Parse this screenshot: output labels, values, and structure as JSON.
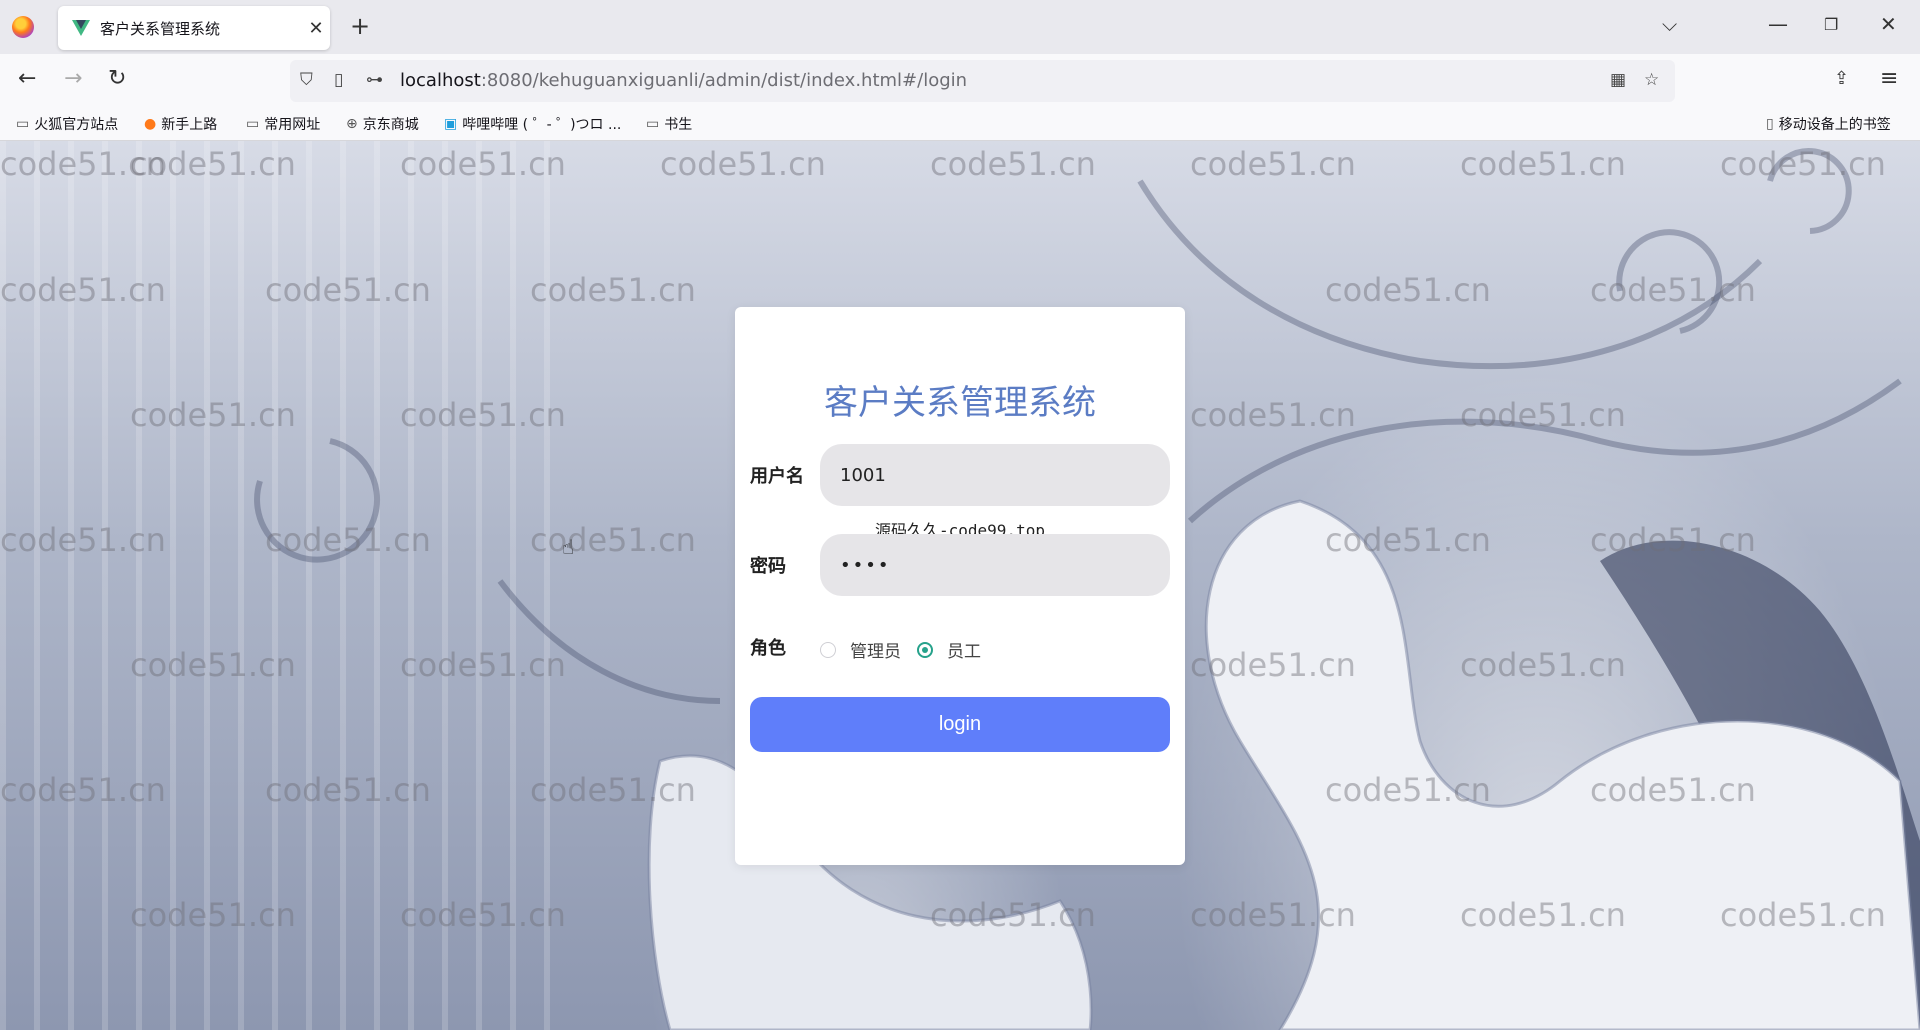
{
  "browser": {
    "tab_title": "客户关系管理系统",
    "url_host": "localhost",
    "url_rest": ":8080/kehuguanxiguanli/admin/dist/index.html#/login",
    "bookmarks": [
      "火狐官方站点",
      "新手上路",
      "常用网址",
      "京东商城",
      "哔哩哔哩 ( ゜- ゜)つロ ...",
      "书生"
    ],
    "mobile_bookmarks": "移动设备上的书签"
  },
  "login": {
    "title": "客户关系管理系统",
    "username_label": "用户名",
    "username_value": "1001",
    "hint": "源码久久-code99.top",
    "password_label": "密码",
    "password_value": "1234",
    "role_label": "角色",
    "role_options": [
      "管理员",
      "员工"
    ],
    "selected_role": "员工",
    "login_label": "login"
  },
  "watermark_text": "code51.cn",
  "colors": {
    "title": "#5b7cc4",
    "button": "#5f7efa",
    "radio_selected": "#26a28b"
  }
}
